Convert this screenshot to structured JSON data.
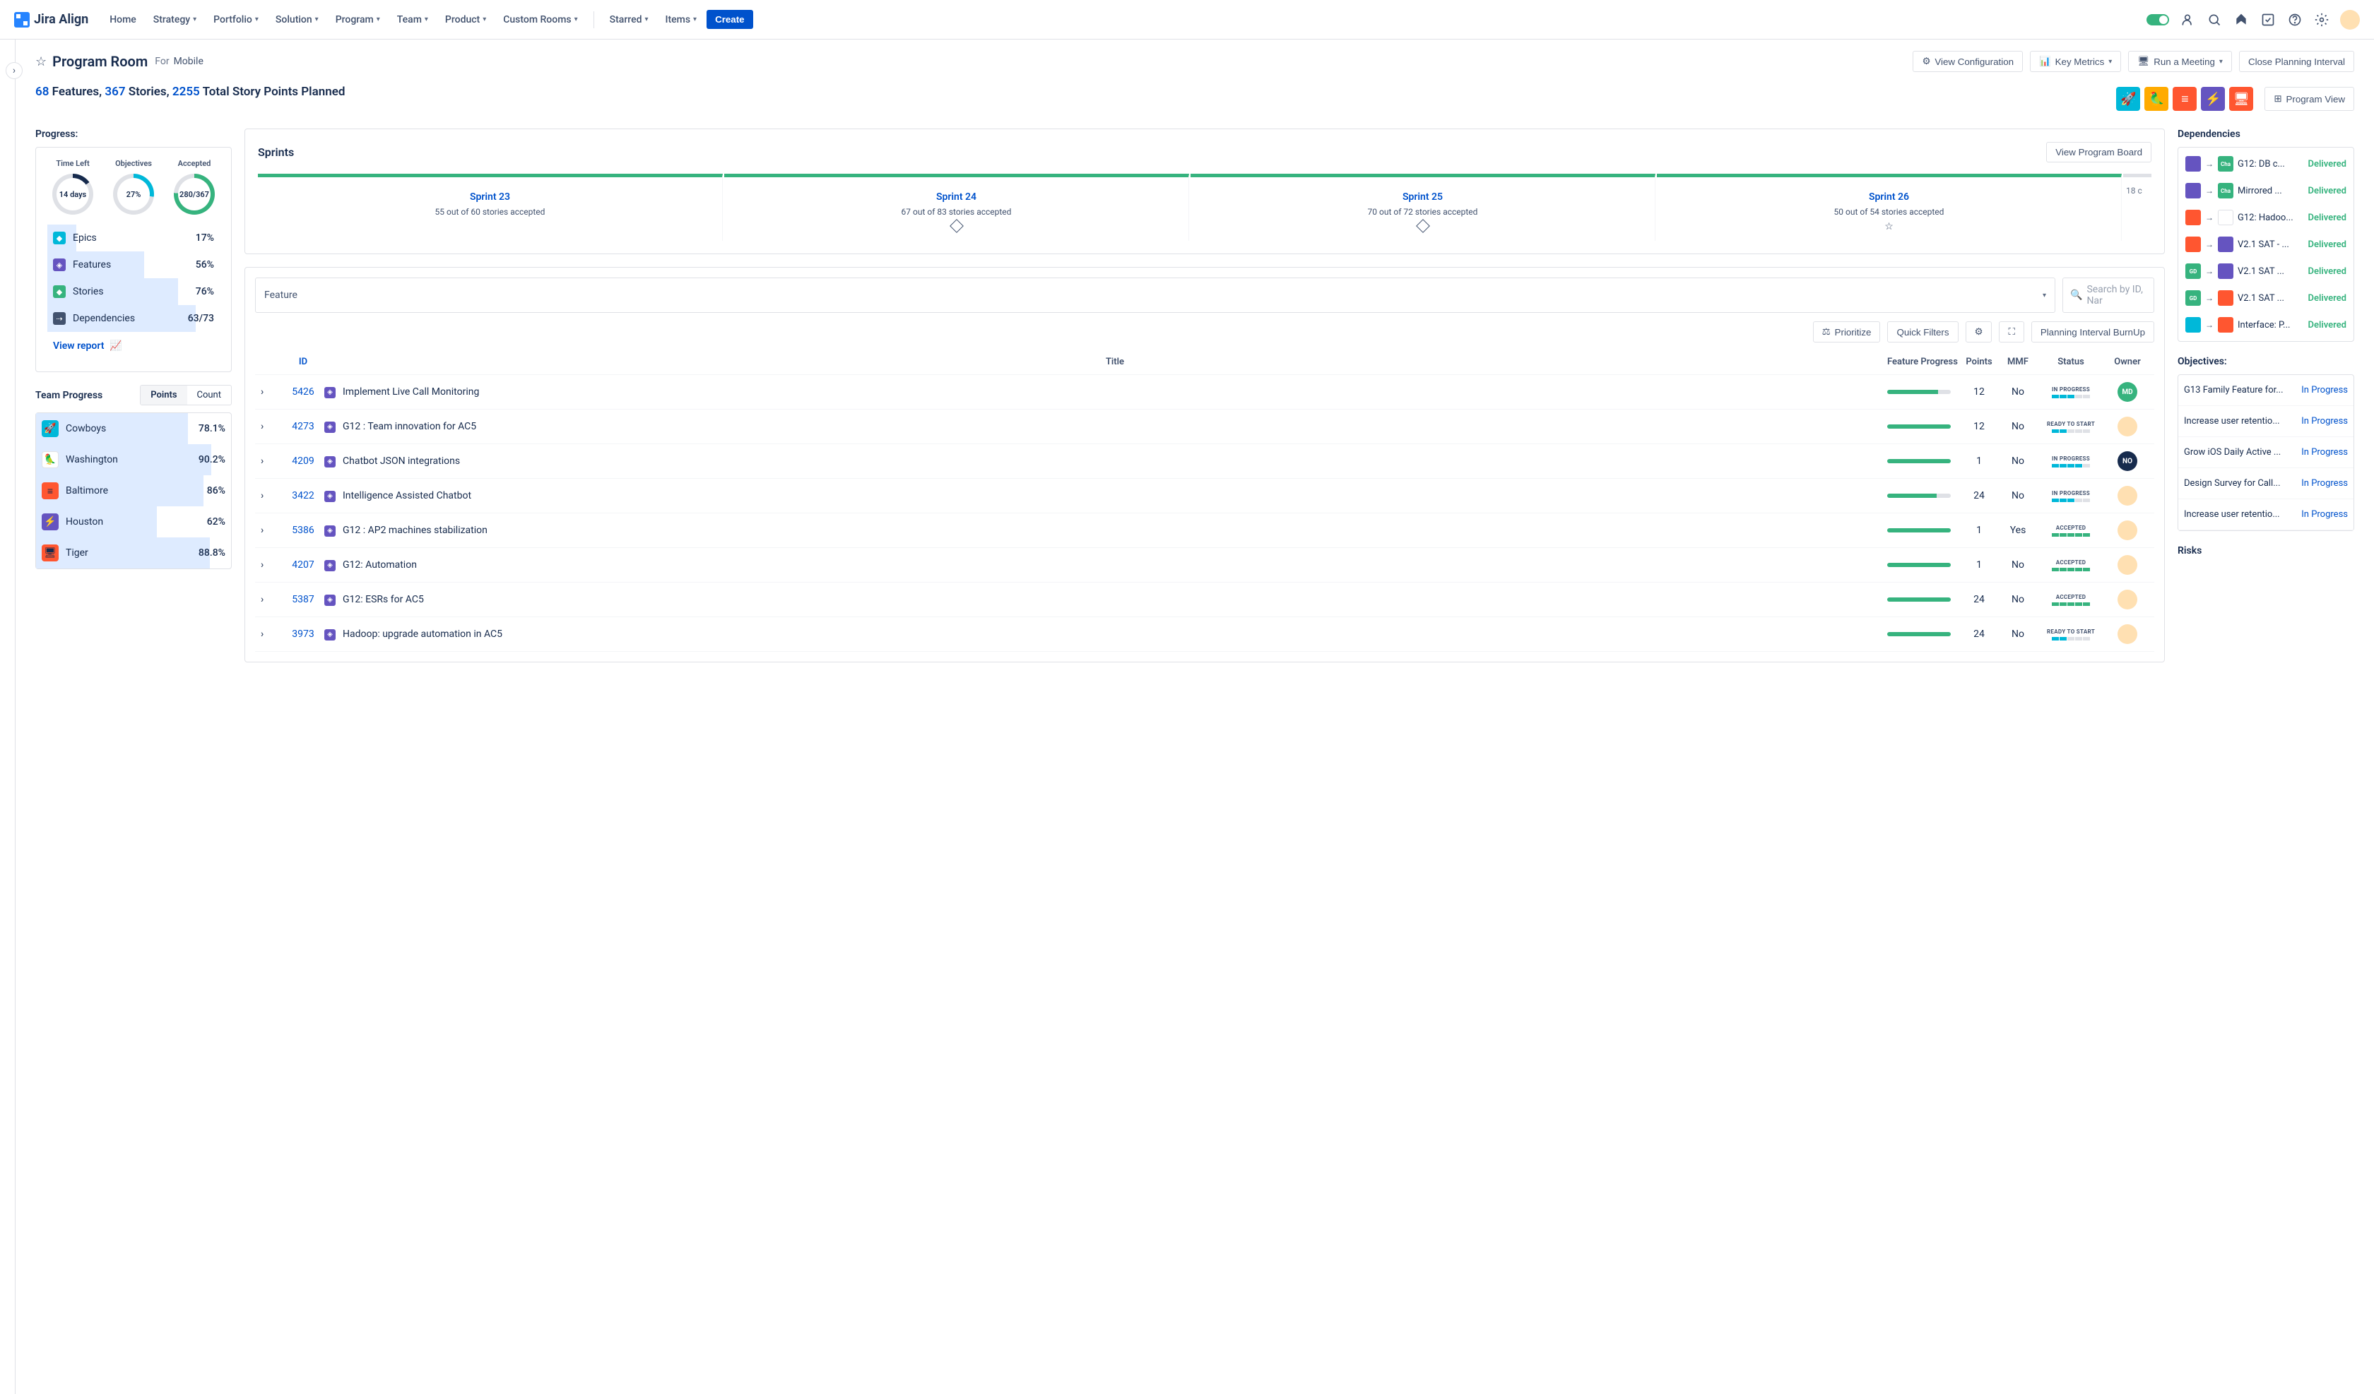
{
  "topnav": {
    "brand": "Jira Align",
    "items": [
      "Home",
      "Strategy",
      "Portfolio",
      "Solution",
      "Program",
      "Team",
      "Product",
      "Custom Rooms"
    ],
    "items2": [
      "Starred",
      "Items"
    ],
    "create": "Create"
  },
  "page": {
    "title": "Program Room",
    "for_label": "For",
    "for_value": "Mobile",
    "view_config": "View Configuration",
    "key_metrics": "Key Metrics",
    "run_meeting": "Run a Meeting",
    "close_pi": "Close Planning Interval"
  },
  "summary": {
    "features_n": "68",
    "features_w": " Features, ",
    "stories_n": "367",
    "stories_w": " Stories, ",
    "points_n": "2255",
    "points_w": " Total Story Points Planned",
    "program_view": "Program View"
  },
  "progress": {
    "label": "Progress:",
    "gauges": [
      {
        "label": "Time Left",
        "value": "14 days"
      },
      {
        "label": "Objectives",
        "value": "27%"
      },
      {
        "label": "Accepted",
        "value": "280/367"
      }
    ],
    "rows": [
      {
        "label": "Epics",
        "value": "17%",
        "bar": 17
      },
      {
        "label": "Features",
        "value": "56%",
        "bar": 56
      },
      {
        "label": "Stories",
        "value": "76%",
        "bar": 76
      },
      {
        "label": "Dependencies",
        "value": "63/73",
        "bar": 86
      }
    ],
    "view_report": "View report"
  },
  "team_progress": {
    "label": "Team Progress",
    "tabs": [
      "Points",
      "Count"
    ],
    "rows": [
      {
        "name": "Cowboys",
        "pct": "78.1%",
        "bar": 78
      },
      {
        "name": "Washington",
        "pct": "90.2%",
        "bar": 90
      },
      {
        "name": "Baltimore",
        "pct": "86%",
        "bar": 86
      },
      {
        "name": "Houston",
        "pct": "62%",
        "bar": 62
      },
      {
        "name": "Tiger",
        "pct": "88.8%",
        "bar": 89
      }
    ]
  },
  "sprints": {
    "title": "Sprints",
    "board_btn": "View Program Board",
    "cols": [
      {
        "name": "Sprint 23",
        "sub": "55 out of 60 stories accepted"
      },
      {
        "name": "Sprint 24",
        "sub": "67 out of 83 stories accepted"
      },
      {
        "name": "Sprint 25",
        "sub": "70 out of 72 stories accepted"
      },
      {
        "name": "Sprint 26",
        "sub": "50 out of 54 stories accepted"
      }
    ],
    "last": "18 c"
  },
  "filters": {
    "type": "Feature",
    "search_ph": "Search by ID, Nar",
    "prioritize": "Prioritize",
    "quick": "Quick Filters",
    "burnup": "Planning Interval BurnUp"
  },
  "table": {
    "headers": {
      "id": "ID",
      "title": "Title",
      "prog": "Feature Progress",
      "pts": "Points",
      "mmf": "MMF",
      "status": "Status",
      "owner": "Owner"
    },
    "rows": [
      {
        "id": "5426",
        "title": "Implement Live Call Monitoring",
        "pts": "12",
        "mmf": "No",
        "status": "IN PROGRESS",
        "seg": "bbbee",
        "prog": 80,
        "own": "md"
      },
      {
        "id": "4273",
        "title": "G12 : Team innovation for AC5",
        "pts": "12",
        "mmf": "No",
        "status": "READY TO START",
        "seg": "bbeee",
        "prog": 100,
        "own": "av"
      },
      {
        "id": "4209",
        "title": "Chatbot JSON integrations",
        "pts": "1",
        "mmf": "No",
        "status": "IN PROGRESS",
        "seg": "bbbbe",
        "prog": 100,
        "own": "no"
      },
      {
        "id": "3422",
        "title": "Intelligence Assisted Chatbot",
        "pts": "24",
        "mmf": "No",
        "status": "IN PROGRESS",
        "seg": "bbbee",
        "prog": 78,
        "own": "av"
      },
      {
        "id": "5386",
        "title": "G12 : AP2 machines stabilization",
        "pts": "1",
        "mmf": "Yes",
        "status": "ACCEPTED",
        "seg": "ggggg",
        "prog": 100,
        "own": "av"
      },
      {
        "id": "4207",
        "title": "G12: Automation",
        "pts": "1",
        "mmf": "No",
        "status": "ACCEPTED",
        "seg": "ggggg",
        "prog": 100,
        "own": "av"
      },
      {
        "id": "5387",
        "title": "G12: ESRs for AC5",
        "pts": "24",
        "mmf": "No",
        "status": "ACCEPTED",
        "seg": "ggggg",
        "prog": 100,
        "own": "av"
      },
      {
        "id": "3973",
        "title": "Hadoop: upgrade automation in AC5",
        "pts": "24",
        "mmf": "No",
        "status": "READY TO START",
        "seg": "bbeee",
        "prog": 100,
        "own": "av"
      }
    ]
  },
  "deps": {
    "label": "Dependencies",
    "rows": [
      {
        "a": "di0",
        "b": "di1",
        "txt": "G12: DB c...",
        "btxt": "Cha",
        "stat": "Delivered"
      },
      {
        "a": "di0",
        "b": "di1",
        "txt": "Mirrored ...",
        "btxt": "Cha",
        "stat": "Delivered"
      },
      {
        "a": "di2",
        "b": "di3",
        "txt": "G12: Hadoo...",
        "stat": "Delivered"
      },
      {
        "a": "di2",
        "b": "di4",
        "txt": "V2.1 SAT - ...",
        "stat": "Delivered"
      },
      {
        "a": "di-gd",
        "b": "di0",
        "txt": "V2.1 SAT ...",
        "atxt": "GD",
        "stat": "Delivered"
      },
      {
        "a": "di-gd",
        "b": "di2",
        "txt": "V2.1 SAT ...",
        "atxt": "GD",
        "stat": "Delivered"
      },
      {
        "a": "di5",
        "b": "di2",
        "txt": "Interface: P...",
        "stat": "Delivered"
      }
    ]
  },
  "objectives": {
    "label": "Objectives:",
    "rows": [
      {
        "txt": "G13 Family Feature for...",
        "stat": "In Progress"
      },
      {
        "txt": "Increase user retentio...",
        "stat": "In Progress"
      },
      {
        "txt": "Grow iOS Daily Active ...",
        "stat": "In Progress"
      },
      {
        "txt": "Design Survey for Call...",
        "stat": "In Progress"
      },
      {
        "txt": "Increase user retentio...",
        "stat": "In Progress"
      }
    ]
  },
  "risks_label": "Risks"
}
